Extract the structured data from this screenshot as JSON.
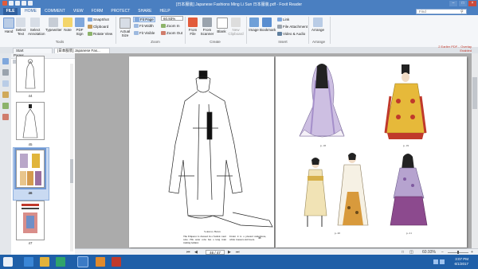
{
  "window": {
    "title": "[日本服装] Japanese Fashions Ming Li Sun 日本服装.pdf - Foxit Reader",
    "buttons": [
      "–",
      "□",
      "×"
    ]
  },
  "menu": {
    "file": "FILE",
    "tabs": [
      "HOME",
      "COMMENT",
      "VIEW",
      "FORM",
      "PROTECT",
      "SHARE",
      "HELP"
    ],
    "active_tab": "HOME",
    "search_placeholder": "Find"
  },
  "ribbon": {
    "hand": "Hand",
    "select_text": "Select Text",
    "select_annotation": "Select Annotation",
    "typewriter": "Typewriter",
    "note": "Note",
    "pdf_sign": "PDF Sign",
    "snapshot": "SnapShot",
    "clipboard": "Clipboard",
    "ruler_view": "Rotate View",
    "actual_size": "Actual Size",
    "fit_page": "Fit Page",
    "fit_width": "Fit Width",
    "fit_visible": "Fit Visible",
    "zoom_value": "60.93%",
    "zoom_in": "Zoom In",
    "zoom_out": "Zoom Out",
    "from_file": "From File",
    "from_scanner": "From Scanner",
    "blank": "Blank",
    "new_clipboard": "New Clipboard",
    "image": "Image",
    "bookmark": "Bookmark",
    "link": "Link",
    "file_attachment": "File Attachment",
    "video_audio": "Video & Audio",
    "arrange": "Arrange",
    "groups": [
      "Tools",
      "Zoom",
      "Create",
      "Insert",
      "Arrange"
    ]
  },
  "doctabs": {
    "start": "Start",
    "doc": "[日本服装] Japanese Fas..."
  },
  "pages_panel": {
    "header": "Pages",
    "thumb_labels": [
      "44",
      "45",
      "46",
      "47"
    ]
  },
  "page_left": {
    "caption": "Sokutai, Heian",
    "body_left": "The Emperor is dressed in a formal court robe. His outer robe has a long train trailing behind.",
    "body_right": "Under it is a pleated underdress, white trousers and boots.",
    "page_number": "45"
  },
  "page_right": {
    "captions": [
      "p. 18",
      "p. 19",
      "p. 20",
      "p. 21"
    ]
  },
  "notice": "2 Earlier PDF... Overlay Enabled",
  "statusbar": {
    "page_field": "46 / 47",
    "zoom": "60.93%"
  },
  "taskbar": {
    "time": "3:07 PM",
    "date": "6/1/2017"
  },
  "colors": {
    "accent": "#4a7fc1",
    "taskbar": "#1f5fa8",
    "close": "#c94a3c"
  }
}
